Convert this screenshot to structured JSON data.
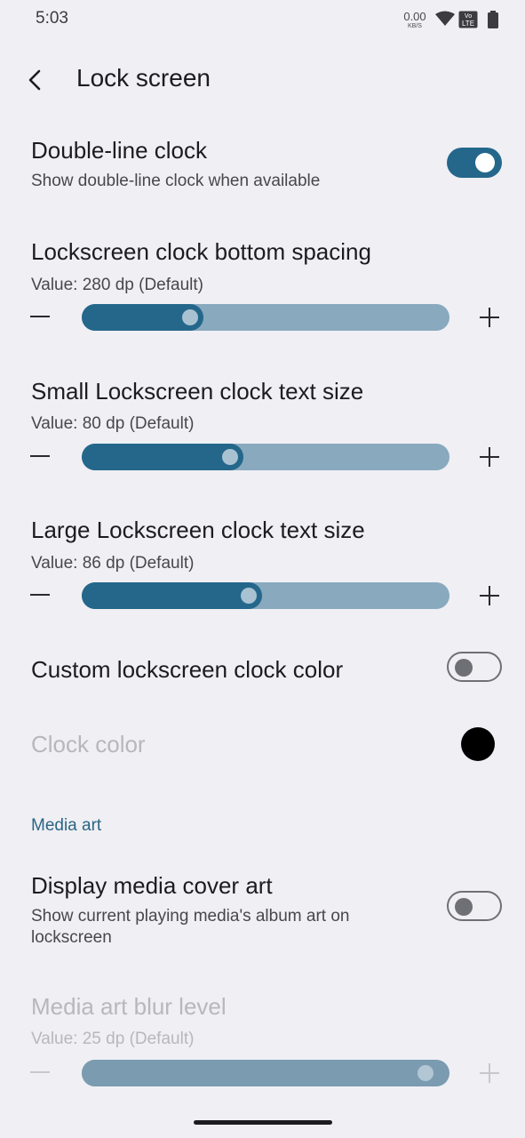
{
  "status": {
    "time": "5:03",
    "net_speed": "0.00",
    "net_unit": "KB/S",
    "volte": "Vo LTE"
  },
  "app_bar": {
    "title": "Lock screen"
  },
  "items": {
    "double_line": {
      "title": "Double-line clock",
      "subtitle": "Show double-line clock when available",
      "enabled": true
    },
    "bottom_spacing": {
      "title": "Lockscreen clock bottom spacing",
      "value_text": "Value: 280 dp (Default)",
      "fraction": 0.33
    },
    "small_text": {
      "title": "Small Lockscreen clock text size",
      "value_text": "Value: 80 dp (Default)",
      "fraction": 0.44
    },
    "large_text": {
      "title": "Large Lockscreen clock text size",
      "value_text": "Value: 86 dp (Default)",
      "fraction": 0.49
    },
    "custom_color": {
      "title": "Custom lockscreen clock color",
      "enabled": false
    },
    "clock_color": {
      "title": "Clock color",
      "color": "#000000"
    }
  },
  "section_media": {
    "label": "Media art"
  },
  "media": {
    "display_cover": {
      "title": "Display media cover art",
      "subtitle": "Show current playing media's album art on lockscreen",
      "enabled": false
    },
    "blur_level": {
      "title": "Media art blur level",
      "value_text": "Value: 25 dp (Default)",
      "fraction": 0.97
    }
  },
  "colors": {
    "accent": "#24678b",
    "track": "#88a9be",
    "background": "#efeff4"
  }
}
